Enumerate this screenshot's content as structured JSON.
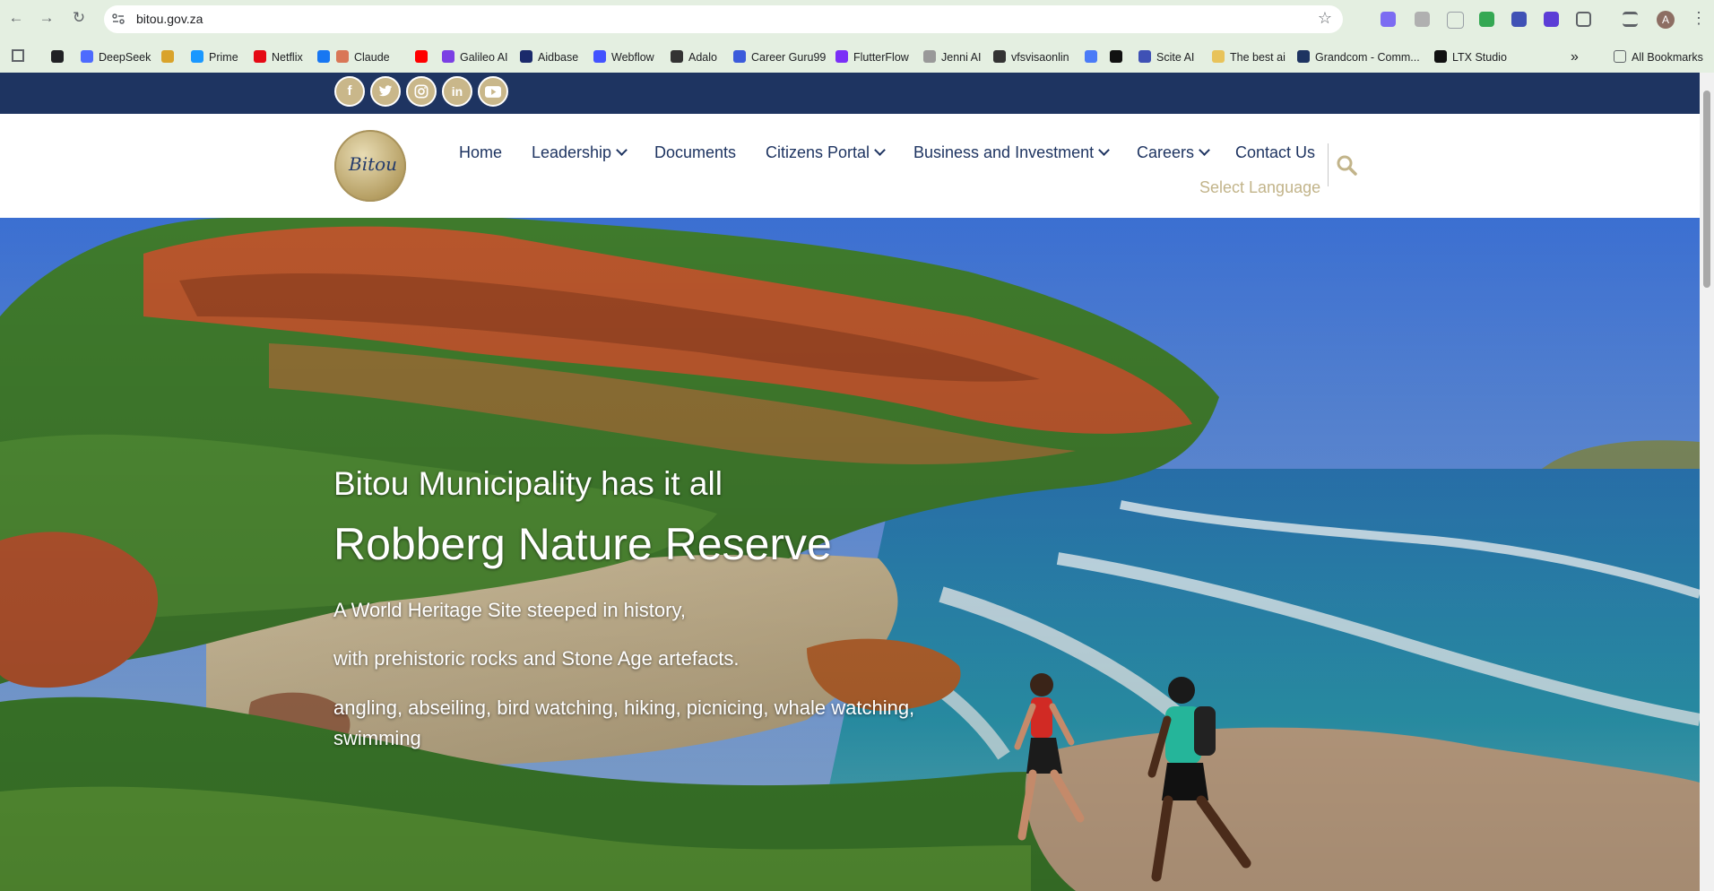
{
  "browser": {
    "url": "bitou.gov.za",
    "profile_initial": "A",
    "bookmarks": [
      {
        "label": "",
        "color": "#202124"
      },
      {
        "label": "DeepSeek",
        "color": "#4d6bfe"
      },
      {
        "label": "",
        "color": "#d9a32b"
      },
      {
        "label": "Prime",
        "color": "#1a98ff"
      },
      {
        "label": "Netflix",
        "color": "#e50914"
      },
      {
        "label": "",
        "color": "#1877f2"
      },
      {
        "label": "Claude",
        "color": "#d97757"
      },
      {
        "label": "",
        "color": "#ff0000"
      },
      {
        "label": "Galileo AI",
        "color": "#7b3fe4"
      },
      {
        "label": "Aidbase",
        "color": "#1b2a6b"
      },
      {
        "label": "Webflow",
        "color": "#4353ff"
      },
      {
        "label": "Adalo",
        "color": "#333333"
      },
      {
        "label": "Career Guru99",
        "color": "#3b5bdb"
      },
      {
        "label": "FlutterFlow",
        "color": "#7b2ff7"
      },
      {
        "label": "Jenni AI",
        "color": "#999999"
      },
      {
        "label": "vfsvisaonlin",
        "color": "#333333"
      },
      {
        "label": "",
        "color": "#4a7bf7"
      },
      {
        "label": "",
        "color": "#111111"
      },
      {
        "label": "Scite AI",
        "color": "#3f51b5"
      },
      {
        "label": "The best ai",
        "color": "#e8c35a"
      },
      {
        "label": "Grandcom - Comm...",
        "color": "#1e3461"
      },
      {
        "label": "LTX Studio",
        "color": "#111111"
      }
    ],
    "all_bookmarks_label": "All Bookmarks"
  },
  "site": {
    "social": [
      "f",
      "t",
      "ig",
      "in",
      "yt"
    ],
    "logo_text": "Bitou",
    "nav": [
      {
        "label": "Home",
        "dropdown": false
      },
      {
        "label": "Leadership",
        "dropdown": true
      },
      {
        "label": "Documents",
        "dropdown": false
      },
      {
        "label": "Citizens Portal",
        "dropdown": true
      },
      {
        "label": "Business and Investment",
        "dropdown": true
      },
      {
        "label": "Careers",
        "dropdown": true
      },
      {
        "label": "Contact Us",
        "dropdown": false
      }
    ],
    "language_select": "Select Language",
    "colors": {
      "navy": "#1e3461",
      "gold": "#c2b48a"
    }
  },
  "hero": {
    "kicker": "Bitou Municipality has it all",
    "title": "Robberg Nature Reserve",
    "lines": [
      "A World Heritage Site steeped in history,",
      "with prehistoric rocks and Stone Age artefacts.",
      "angling, abseiling, bird watching, hiking, picnicing, whale watching,",
      "swimming"
    ]
  }
}
